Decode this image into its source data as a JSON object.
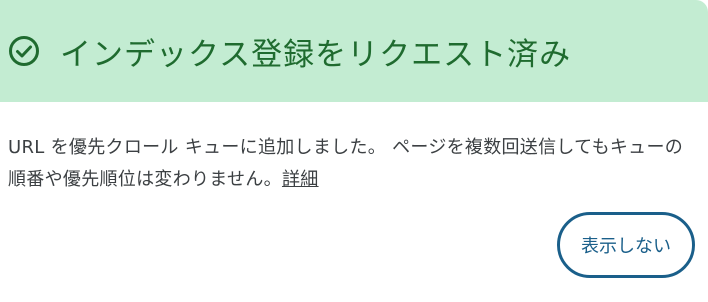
{
  "header": {
    "title": "インデックス登録をリクエスト済み",
    "icon": "check-circle-icon",
    "background_color": "#c3ecd2",
    "accent_color": "#1f6b2f"
  },
  "message": {
    "text": "URL を優先クロール キューに追加しました。 ページを複数回送信してもキューの順番や優先順位は変わりません。",
    "link_label": "詳細"
  },
  "actions": {
    "dismiss_label": "表示しない",
    "button_color": "#1a5f8a"
  }
}
